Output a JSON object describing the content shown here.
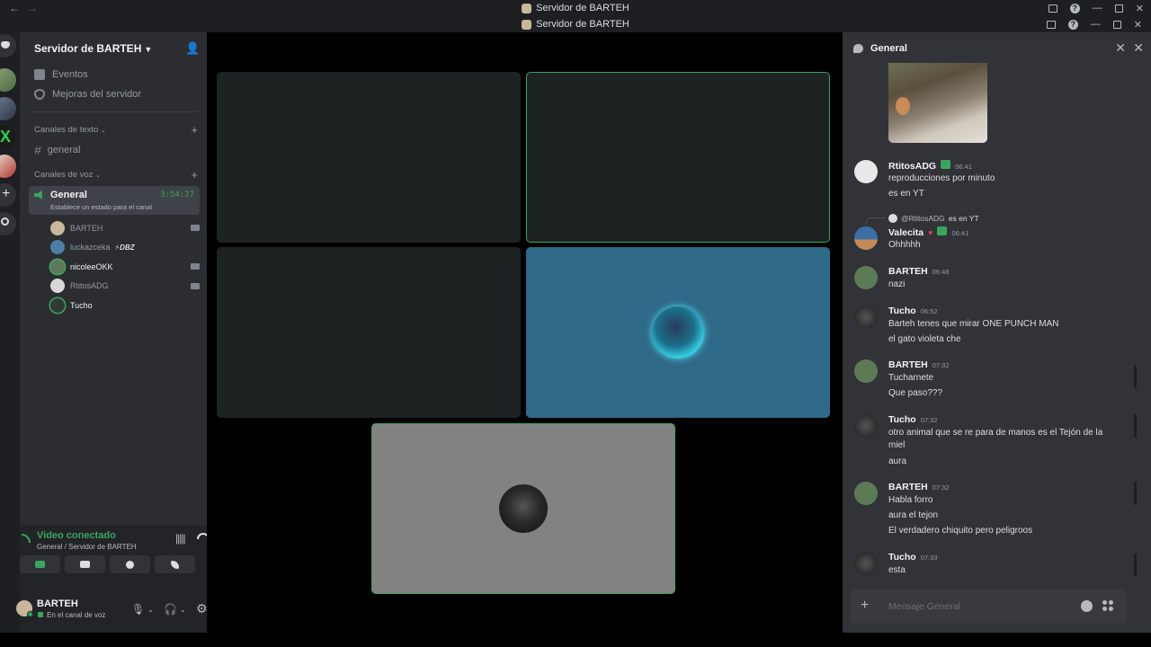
{
  "window": {
    "title": "Servidor de BARTEH",
    "title2": "Servidor de BARTEH"
  },
  "sidebar": {
    "server_name": "Servidor de BARTEH",
    "menu": [
      {
        "label": "Eventos",
        "icon": "calendar-icon"
      },
      {
        "label": "Mejoras del servidor",
        "icon": "boost-icon"
      }
    ],
    "text_category": "Canales de texto",
    "text_channels": [
      {
        "label": "general"
      }
    ],
    "voice_category": "Canales de voz",
    "voice_channel": {
      "name": "General",
      "timer": "3:54:27",
      "status": "Establece un estado para el canal"
    },
    "voice_users": [
      {
        "name": "BARTEH",
        "camera": true,
        "bright": false,
        "color": "#c9b79a"
      },
      {
        "name": "luckazceka",
        "camera": false,
        "bright": false,
        "status": "⚡DBZ",
        "color": "#4a7fa8"
      },
      {
        "name": "nicoleeOKK",
        "camera": true,
        "bright": true,
        "color": "#5c7a5a"
      },
      {
        "name": "RtitosADG",
        "camera": true,
        "bright": false,
        "color": "#d8d8d8"
      },
      {
        "name": "Tucho",
        "camera": false,
        "bright": true,
        "color": "#2e3a33"
      }
    ]
  },
  "rtc": {
    "status": "Video conectado",
    "location": "General / Servidor de BARTEH"
  },
  "user": {
    "name": "BARTEH",
    "status": "En el canal de voz"
  },
  "chat": {
    "title": "General",
    "placeholder": "Mensaje General",
    "messages": [
      {
        "author": "RtitosADG",
        "time": "06:41",
        "lines": [
          "reproducciones por minuto",
          "es en YT"
        ],
        "avatar": "#e8e8e8"
      },
      {
        "reply_to": "@RtitosADG",
        "reply_text": "es en YT",
        "author": "Valecita",
        "time": "06:41",
        "lines": [
          "Ohhhhh"
        ],
        "avatar": "#3d6fa5"
      },
      {
        "author": "BARTEH",
        "time": "06:48",
        "lines": [
          "nazi"
        ],
        "avatar": "#5d7a56"
      },
      {
        "author": "Tucho",
        "time": "06:52",
        "lines": [
          "Barteh tenes que mirar ONE PUNCH MAN",
          "el gato violeta che"
        ],
        "avatar": "#2b2b2b"
      },
      {
        "author": "BARTEH",
        "time": "07:32",
        "lines": [
          "Tucharnete",
          "Que paso???"
        ],
        "avatar": "#5d7a56"
      },
      {
        "author": "Tucho",
        "time": "07:32",
        "lines": [
          "otro animal que se re para de manos es el Tejón de la",
          "miel",
          "aura"
        ],
        "avatar": "#2b2b2b"
      },
      {
        "author": "BARTEH",
        "time": "07:32",
        "lines": [
          "Habla forro",
          "aura el tejon",
          "El verdadero chiquito pero peligroos"
        ],
        "avatar": "#5d7a56"
      },
      {
        "author": "Tucho",
        "time": "07:33",
        "lines": [
          "esta"
        ],
        "avatar": "#2b2b2b"
      }
    ]
  },
  "colors": {
    "accent_green": "#3ba55d",
    "tile_dark": "#1c2322",
    "tile_blue": "#2f6a88",
    "tile_gray": "#828282"
  }
}
